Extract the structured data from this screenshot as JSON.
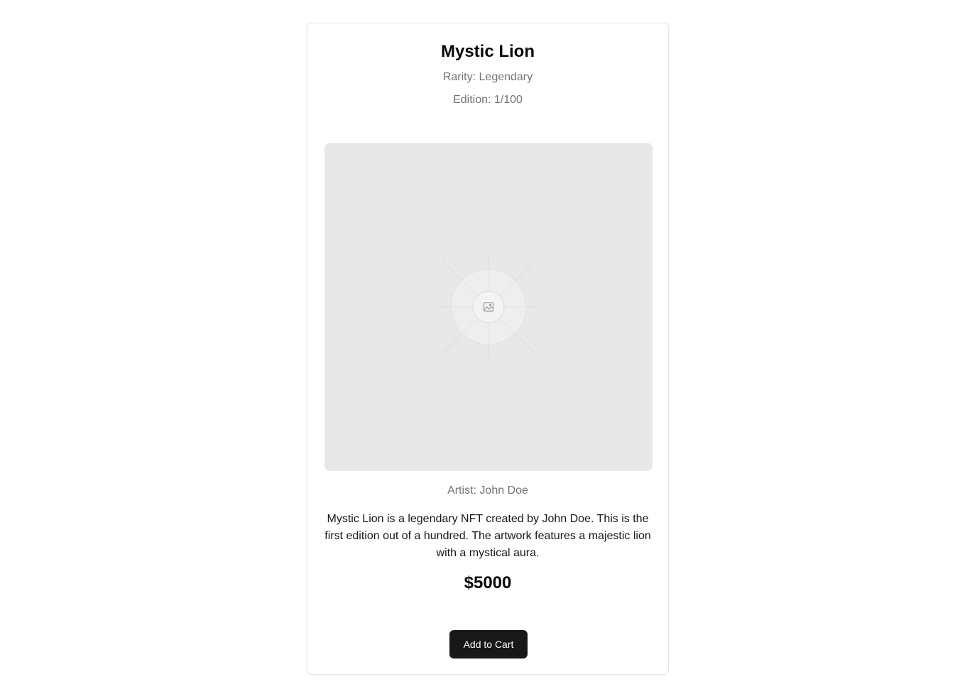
{
  "product": {
    "title": "Mystic Lion",
    "rarity": "Rarity: Legendary",
    "edition": "Edition: 1/100",
    "image_icon": "image-icon",
    "artist": "Artist: John Doe",
    "description": "Mystic Lion is a legendary NFT created by John Doe. This is the first edition out of a hundred. The artwork features a majestic lion with a mystical aura.",
    "price": "$5000",
    "add_to_cart_label": "Add to Cart"
  },
  "colors": {
    "button_bg": "#18181b",
    "muted_text": "#71717a",
    "placeholder_bg": "#e8e8e8"
  }
}
